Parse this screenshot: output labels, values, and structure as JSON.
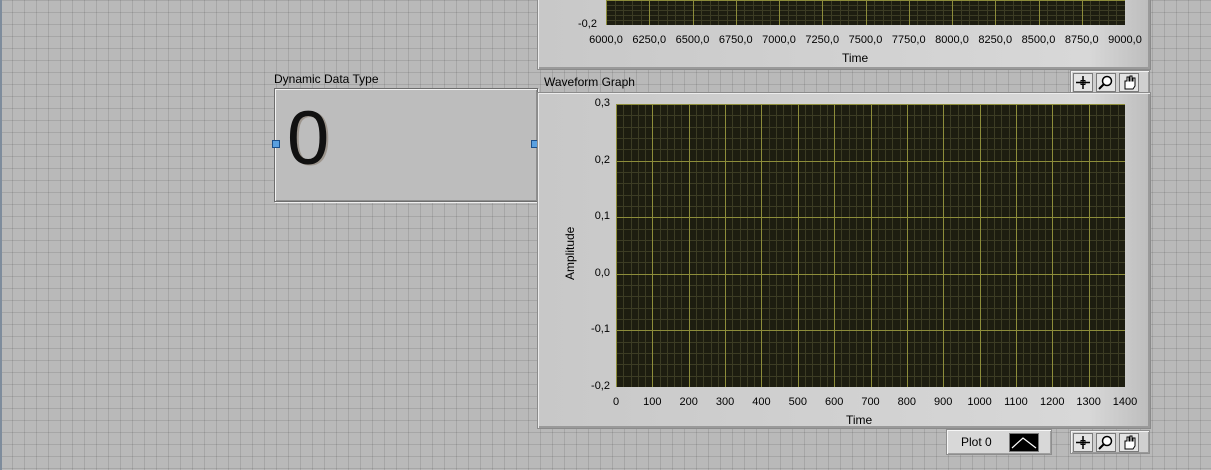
{
  "indicator": {
    "label": "Dynamic Data Type",
    "value": "0"
  },
  "top_graph": {
    "x_ticks": [
      "6000,0",
      "6250,0",
      "6500,0",
      "6750,0",
      "7000,0",
      "7250,0",
      "7500,0",
      "7750,0",
      "8000,0",
      "8250,0",
      "8500,0",
      "8750,0",
      "9000,0"
    ],
    "y_visible_tick": "-0,2",
    "x_title": "Time"
  },
  "waveform_graph": {
    "title": "Waveform Graph",
    "y_title": "Amplitude",
    "x_title": "Time",
    "y_ticks": [
      "0,3",
      "0,2",
      "0,1",
      "0,0",
      "-0,1",
      "-0,2"
    ],
    "x_ticks": [
      "0",
      "100",
      "200",
      "300",
      "400",
      "500",
      "600",
      "700",
      "800",
      "900",
      "1000",
      "1100",
      "1200",
      "1300",
      "1400"
    ]
  },
  "legend": {
    "plot_name": "Plot 0"
  },
  "palette": {
    "tools": [
      "crosshair-icon",
      "zoom-icon",
      "pan-hand-icon"
    ]
  },
  "colors": {
    "plot_bg": "#1d1d10",
    "grid_major": "#8d8d3a",
    "grid_minor": "#3c3c24"
  }
}
